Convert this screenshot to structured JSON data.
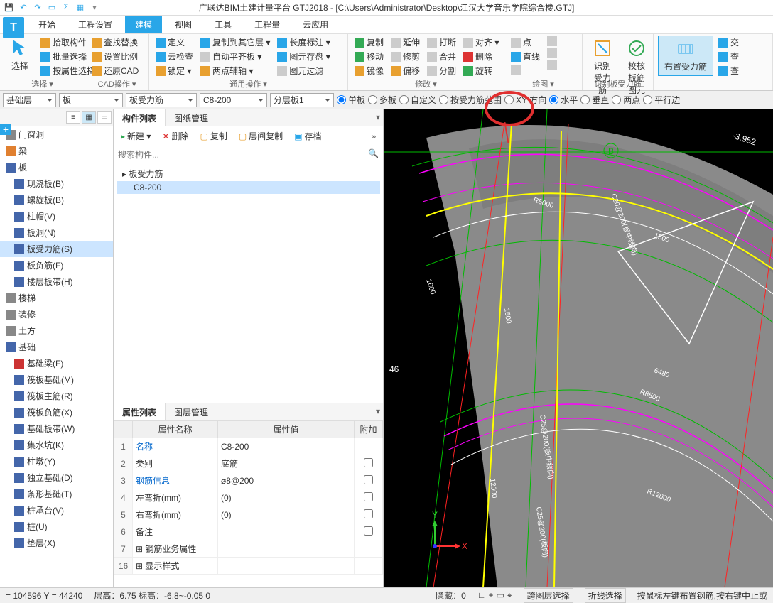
{
  "title": "广联达BIM土建计量平台 GTJ2018 - [C:\\Users\\Administrator\\Desktop\\江汉大学音乐学院综合楼.GTJ]",
  "menutabs": [
    "开始",
    "工程设置",
    "建模",
    "视图",
    "工具",
    "工程量",
    "云应用"
  ],
  "ribbon": {
    "select": {
      "big": "选择",
      "items": [
        "拾取构件",
        "批量选择",
        "按属性选择"
      ],
      "label": "选择 ▾"
    },
    "cad": {
      "items": [
        "查找替换",
        "设置比例",
        "还原CAD",
        "定义",
        "云检查",
        "锁定 ▾",
        "复制到其它层 ▾",
        "自动平齐板 ▾",
        "两点辅轴 ▾",
        "长度标注 ▾",
        "图元存盘 ▾",
        "图元过滤"
      ],
      "label": "CAD操作 ▾",
      "label2": "通用操作 ▾"
    },
    "modify": {
      "items": [
        "复制",
        "移动",
        "镜像",
        "延伸",
        "修剪",
        "偏移",
        "打断",
        "合并",
        "分割",
        "对齐 ▾",
        "删除",
        "旋转"
      ],
      "label": "修改 ▾"
    },
    "draw": {
      "items": [
        "点",
        "直线"
      ],
      "label": "绘图 ▾"
    },
    "rebar": {
      "items": [
        "识别受力筋",
        "校核板筋图元"
      ],
      "label": "识别板受力筋"
    },
    "layout": {
      "big": "布置受力筋",
      "items": [
        "交",
        "查",
        "查"
      ]
    }
  },
  "optbar": {
    "combos": [
      "基础层",
      "板",
      "板受力筋",
      "C8-200",
      "分层板1"
    ],
    "radios": [
      "单板",
      "多板",
      "自定义",
      "按受力筋范围",
      "XY 方向",
      "水平",
      "垂直",
      "两点",
      "平行边"
    ]
  },
  "tree": {
    "items": [
      {
        "t": "门窗洞",
        "cat": true,
        "ico": "#888"
      },
      {
        "t": "梁",
        "cat": true,
        "ico": "#e08030"
      },
      {
        "t": "板",
        "cat": true,
        "ico": "#46a"
      },
      {
        "t": "现浇板(B)",
        "ico": "#46a"
      },
      {
        "t": "螺旋板(B)",
        "ico": "#46a"
      },
      {
        "t": "柱帽(V)",
        "ico": "#46a"
      },
      {
        "t": "板洞(N)",
        "ico": "#46a"
      },
      {
        "t": "板受力筋(S)",
        "ico": "#46a",
        "sel": true
      },
      {
        "t": "板负筋(F)",
        "ico": "#46a"
      },
      {
        "t": "楼层板带(H)",
        "ico": "#46a"
      },
      {
        "t": "楼梯",
        "cat": true,
        "ico": "#888"
      },
      {
        "t": "装修",
        "cat": true,
        "ico": "#888"
      },
      {
        "t": "土方",
        "cat": true,
        "ico": "#888"
      },
      {
        "t": "基础",
        "cat": true,
        "ico": "#46a"
      },
      {
        "t": "基础梁(F)",
        "ico": "#c33"
      },
      {
        "t": "筏板基础(M)",
        "ico": "#46a"
      },
      {
        "t": "筏板主筋(R)",
        "ico": "#46a"
      },
      {
        "t": "筏板负筋(X)",
        "ico": "#46a"
      },
      {
        "t": "基础板带(W)",
        "ico": "#46a"
      },
      {
        "t": "集水坑(K)",
        "ico": "#46a"
      },
      {
        "t": "柱墩(Y)",
        "ico": "#46a"
      },
      {
        "t": "独立基础(D)",
        "ico": "#46a"
      },
      {
        "t": "条形基础(T)",
        "ico": "#46a"
      },
      {
        "t": "桩承台(V)",
        "ico": "#46a"
      },
      {
        "t": "桩(U)",
        "ico": "#46a"
      },
      {
        "t": "垫层(X)",
        "ico": "#46a"
      }
    ]
  },
  "mid": {
    "tabs": [
      "构件列表",
      "图纸管理"
    ],
    "toolbar": [
      "新建 ▾",
      "删除",
      "复制",
      "层间复制",
      "存档"
    ],
    "search_ph": "搜索构件...",
    "root": "▸ 板受力筋",
    "item": "C8-200",
    "prop_tabs": [
      "属性列表",
      "图层管理"
    ],
    "prop_head": [
      "",
      "属性名称",
      "属性值",
      "附加"
    ],
    "props": [
      {
        "n": "1",
        "k": "名称",
        "v": "C8-200",
        "link": true
      },
      {
        "n": "2",
        "k": "类别",
        "v": "底筋"
      },
      {
        "n": "3",
        "k": "钢筋信息",
        "v": "⌀8@200",
        "link": true
      },
      {
        "n": "4",
        "k": "左弯折(mm)",
        "v": "(0)"
      },
      {
        "n": "5",
        "k": "右弯折(mm)",
        "v": "(0)"
      },
      {
        "n": "6",
        "k": "备注",
        "v": ""
      },
      {
        "n": "7",
        "k": "钢筋业务属性",
        "v": "",
        "exp": true
      },
      {
        "n": "16",
        "k": "显示样式",
        "v": "",
        "exp": true
      }
    ]
  },
  "canvas": {
    "labels": [
      "R5000",
      "C20@200(板中线向)",
      "1500",
      "1500",
      "R8500",
      "6480",
      "12000",
      "R12000",
      "C25@200(板中线向)",
      "C25@200(板向)",
      "46",
      "-3.952",
      "1600",
      "B"
    ],
    "axis": {
      "x": "X",
      "y": "Y"
    }
  },
  "status": {
    "coord": "= 104596 Y = 44240",
    "floor": "层高：6.75    标高：-6.8~-0.05    0",
    "hide": "隐藏：0",
    "right": [
      "跨图层选择",
      "折线选择",
      "按鼠标左键布置钢筋,按右键中止或"
    ]
  }
}
